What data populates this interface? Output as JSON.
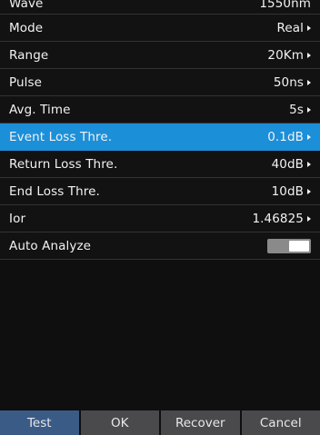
{
  "settings": {
    "rows": [
      {
        "label": "Wave",
        "value": "1550nm"
      },
      {
        "label": "Mode",
        "value": "Real"
      },
      {
        "label": "Range",
        "value": "20Km"
      },
      {
        "label": "Pulse",
        "value": "50ns"
      },
      {
        "label": "Avg. Time",
        "value": "5s"
      },
      {
        "label": "Event Loss Thre.",
        "value": "0.1dB"
      },
      {
        "label": "Return Loss Thre.",
        "value": "40dB"
      },
      {
        "label": "End Loss Thre.",
        "value": "10dB"
      },
      {
        "label": "Ior",
        "value": "1.46825"
      },
      {
        "label": "Auto Analyze",
        "value": ""
      }
    ],
    "auto_analyze_on": true
  },
  "buttons": {
    "test": "Test",
    "ok": "OK",
    "recover": "Recover",
    "cancel": "Cancel"
  },
  "colors": {
    "selected_row": "#1c8fd9",
    "active_button": "#3a5b86",
    "button": "#4a4a4d"
  }
}
